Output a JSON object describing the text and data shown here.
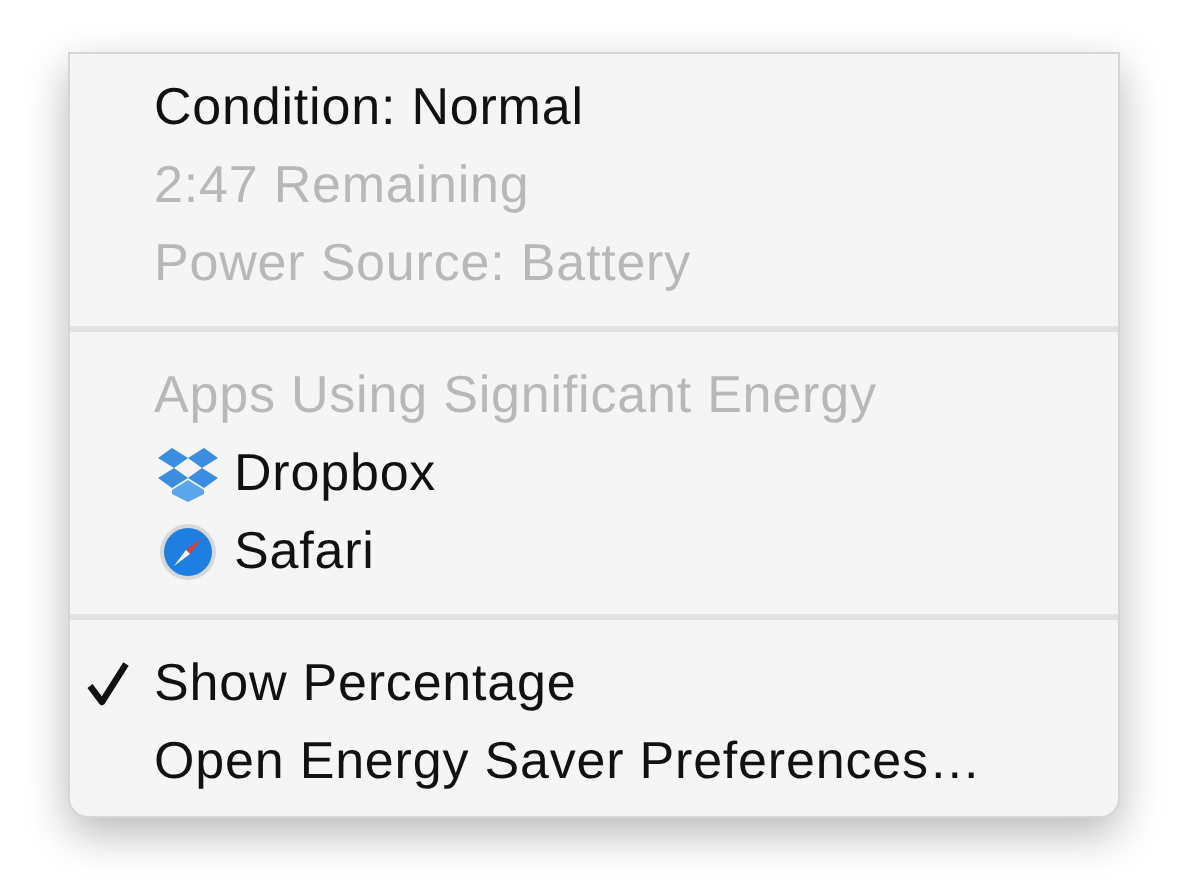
{
  "sections": [
    {
      "items": [
        {
          "label": "Condition: Normal",
          "disabled": false,
          "checked": false
        },
        {
          "label": "2:47 Remaining",
          "disabled": true,
          "checked": false
        },
        {
          "label": "Power Source: Battery",
          "disabled": true,
          "checked": false
        }
      ]
    },
    {
      "items": [
        {
          "label": "Apps Using Significant Energy",
          "disabled": true,
          "checked": false
        },
        {
          "label": "Dropbox",
          "disabled": false,
          "checked": false,
          "kind": "app"
        },
        {
          "label": "Safari",
          "disabled": false,
          "checked": false,
          "kind": "app"
        }
      ]
    },
    {
      "items": [
        {
          "label": "Show Percentage",
          "disabled": false,
          "checked": true
        },
        {
          "label": "Open Energy Saver Preferences…",
          "disabled": false,
          "checked": false
        }
      ]
    }
  ]
}
